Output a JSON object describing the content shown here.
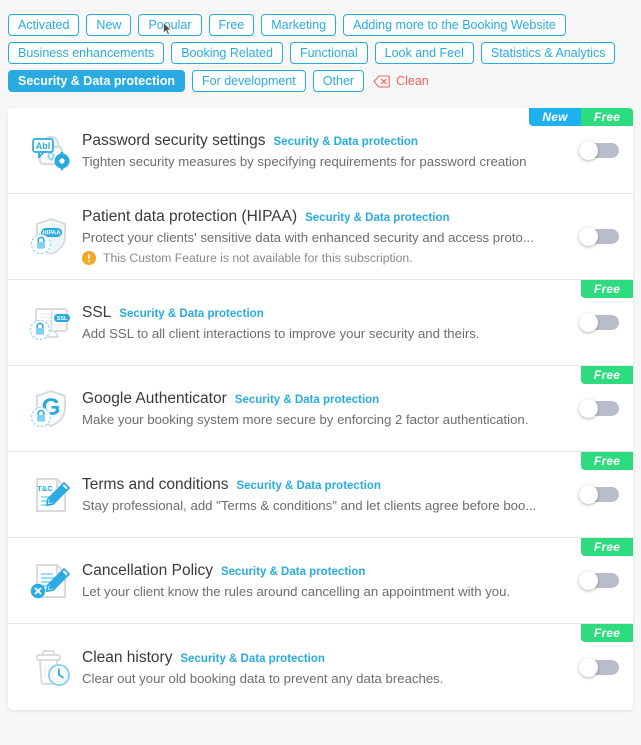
{
  "filters": {
    "tags": [
      {
        "label": "Activated",
        "active": false
      },
      {
        "label": "New",
        "active": false
      },
      {
        "label": "Popular",
        "active": false
      },
      {
        "label": "Free",
        "active": false
      },
      {
        "label": "Marketing",
        "active": false
      },
      {
        "label": "Adding more to the Booking Website",
        "active": false
      },
      {
        "label": "Business enhancements",
        "active": false
      },
      {
        "label": "Booking Related",
        "active": false
      },
      {
        "label": "Functional",
        "active": false
      },
      {
        "label": "Look and Feel",
        "active": false
      },
      {
        "label": "Statistics & Analytics",
        "active": false
      },
      {
        "label": "Security & Data protection",
        "active": true
      },
      {
        "label": "For development",
        "active": false
      },
      {
        "label": "Other",
        "active": false
      }
    ],
    "clean_label": "Clean",
    "clean_icon": "backspace-icon"
  },
  "colors": {
    "accent_blue": "#29abe2",
    "badge_new": "#1eb0f0",
    "badge_free": "#2fdb7f",
    "clean_red": "#f1625e",
    "warning_orange": "#f5a623",
    "toggle_track": "#b9bdc9",
    "page_background": "#f7f7f7"
  },
  "features": [
    {
      "icon": "password-lock-icon",
      "title": "Password security settings",
      "category": "Security & Data protection",
      "description": "Tighten security measures by specifying requirements for password creation",
      "badges": [
        "New",
        "Free"
      ],
      "toggle_state": "off",
      "notice": null
    },
    {
      "icon": "hipaa-shield-icon",
      "title": "Patient data protection (HIPAA)",
      "category": "Security & Data protection",
      "description": "Protect your clients' sensitive data with enhanced security and access proto...",
      "badges": [],
      "toggle_state": "off",
      "notice": "This Custom Feature is not available for this subscription."
    },
    {
      "icon": "ssl-monitor-icon",
      "title": "SSL",
      "category": "Security & Data protection",
      "description": "Add SSL to all client interactions to improve your security and theirs.",
      "badges": [
        "Free"
      ],
      "toggle_state": "off",
      "notice": null
    },
    {
      "icon": "google-authenticator-icon",
      "title": "Google Authenticator",
      "category": "Security & Data protection",
      "description": "Make your booking system more secure by enforcing 2 factor authentication.",
      "badges": [
        "Free"
      ],
      "toggle_state": "off",
      "notice": null
    },
    {
      "icon": "terms-document-icon",
      "title": "Terms and conditions",
      "category": "Security & Data protection",
      "description": "Stay professional, add \"Terms & conditions\" and let clients agree before boo...",
      "badges": [
        "Free"
      ],
      "toggle_state": "off",
      "notice": null
    },
    {
      "icon": "cancellation-document-icon",
      "title": "Cancellation Policy",
      "category": "Security & Data protection",
      "description": "Let your client know the rules around cancelling an appointment with you.",
      "badges": [
        "Free"
      ],
      "toggle_state": "off",
      "notice": null
    },
    {
      "icon": "clean-history-trash-icon",
      "title": "Clean history",
      "category": "Security & Data protection",
      "description": "Clear out your old booking data to prevent any data breaches.",
      "badges": [
        "Free"
      ],
      "toggle_state": "off",
      "notice": null
    }
  ]
}
